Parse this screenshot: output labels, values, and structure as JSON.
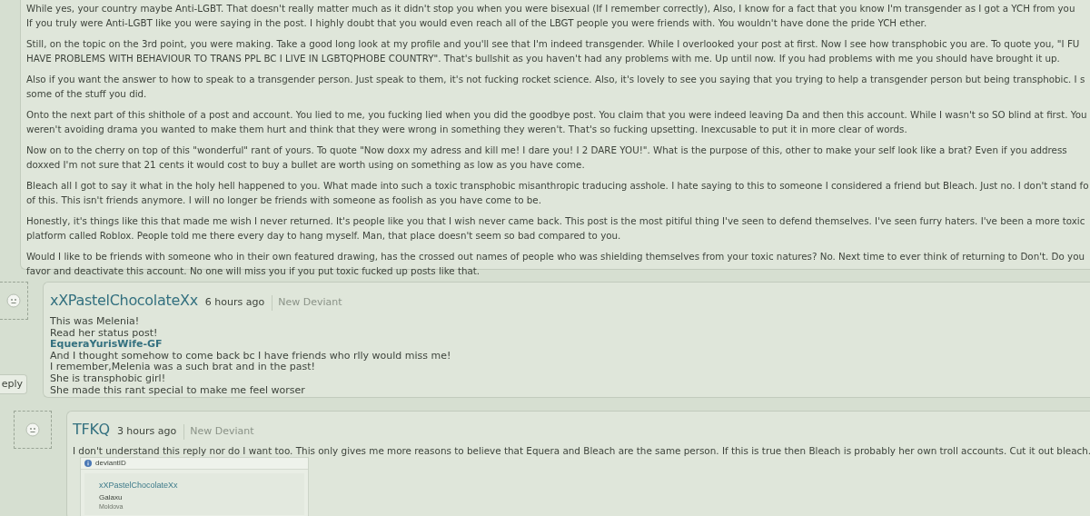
{
  "main_comment": {
    "paragraphs": [
      [
        "While yes, your country maybe Anti-LGBT. That doesn't really matter much as it didn't stop you when you were bisexual (If I remember correctly), Also, I know for a fact that you know I'm transgender as I got a YCH from you",
        "If you truly were Anti-LGBT like you were saying in the post. I highly doubt that you would even reach all of the LBGT people you were friends with. You wouldn't have done the pride YCH ether."
      ],
      [
        "Still, on the topic on the 3rd point, you were making. Take a good long look at my profile and you'll see that I'm indeed transgender. While I overlooked your post at first. Now I see how transphobic you are. To quote you, \"I FU",
        "HAVE PROBLEMS WITH BEHAVIOUR TO TRANS PPL BC I LIVE IN LGBTQPHOBE COUNTRY\". That's bullshit as you haven't had any problems with me. Up until now. If you had problems with me you should have brought it up."
      ],
      [
        "Also if you want the answer to how to speak to a transgender person. Just speak to them, it's not fucking rocket science. Also, it's lovely to see you saying that you trying to help a transgender person but being transphobic. I s",
        "some of the stuff you did."
      ],
      [
        "Onto the next part of this shithole of a post and account. You lied to me, you fucking lied when you did the goodbye post. You claim that you were indeed leaving Da and then this account. While I wasn't so SO blind at first. You",
        "weren't avoiding drama you wanted to make them hurt and think that they were wrong in something they weren't. That's so fucking upsetting. Inexcusable to put it in more clear of words."
      ],
      [
        "Now on to the cherry on top of this \"wonderful\" rant of yours. To quote \"Now doxx my adress and kill me! I dare you! I 2 DARE YOU!\". What is the purpose of this, other to make your self look like a brat? Even if you address",
        "doxxed I'm not sure that 21 cents it would cost to buy a bullet are worth using on something as low as you have come."
      ],
      [
        "Bleach all I got to say it what in the holy hell happened to you. What made into such a toxic transphobic misanthropic traducing asshole. I hate saying to this to someone I considered a friend but Bleach. Just no. I don't stand fo",
        "of this. This isn't friends anymore. I will no longer be friends with someone as foolish as you have come to be."
      ],
      [
        "Honestly, it's things like this that made me wish I never returned. It's people like you that I wish never came back. This post is the most pitiful thing I've seen to defend themselves. I've seen furry haters. I've been a more toxic",
        "platform called Roblox. People told me there every day to hang myself. Man, that place doesn't seem so bad compared to you."
      ],
      [
        "Would I like to be friends with someone who in their own featured drawing, has the crossed out names of people who was shielding themselves from your toxic natures? No. Next time to ever think of returning to Don't. Do you",
        "favor and deactivate this account. No one will miss you if you put toxic fucked up posts like that."
      ]
    ]
  },
  "replies": [
    {
      "username": "xXPastelChocolateXx",
      "time": "6 hours ago",
      "badge": "New Deviant",
      "reply_button": "eply",
      "lines": [
        {
          "kind": "text",
          "text": "This was Melenia!"
        },
        {
          "kind": "text",
          "text": "Read her status post!"
        },
        {
          "kind": "link",
          "text": "EqueraYurisWife-GF"
        },
        {
          "kind": "text",
          "text": "And I thought somehow to come back bc I have friends who rlly would miss me!"
        },
        {
          "kind": "text",
          "text": "I remember,Melenia was a such brat and in the past!"
        },
        {
          "kind": "text",
          "text": "She is transphobic girl!"
        },
        {
          "kind": "text",
          "text": "She made this rant special to make me feel worser"
        }
      ]
    },
    {
      "username": "TFKQ",
      "time": "3 hours ago",
      "badge": "New Deviant",
      "lines": [
        {
          "kind": "text",
          "text": "I don't understand this reply nor do I want too. This only gives me more reasons to believe that Equera and Bleach are the same person. If this is true then Bleach is probably her own troll accounts. Cut it out bleach."
        }
      ],
      "attachment": {
        "header": "deviantID",
        "username": "xXPastelChocolateXx",
        "name": "Galaxu",
        "location": "Moldova"
      }
    }
  ]
}
